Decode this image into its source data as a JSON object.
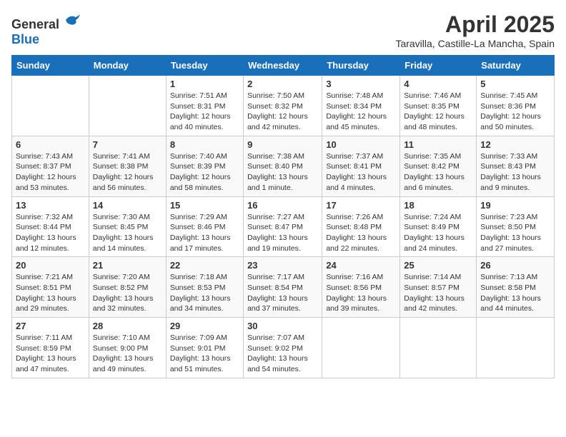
{
  "logo": {
    "general": "General",
    "blue": "Blue"
  },
  "title": "April 2025",
  "subtitle": "Taravilla, Castille-La Mancha, Spain",
  "days_of_week": [
    "Sunday",
    "Monday",
    "Tuesday",
    "Wednesday",
    "Thursday",
    "Friday",
    "Saturday"
  ],
  "weeks": [
    [
      {
        "day": "",
        "info": ""
      },
      {
        "day": "",
        "info": ""
      },
      {
        "day": "1",
        "info": "Sunrise: 7:51 AM\nSunset: 8:31 PM\nDaylight: 12 hours and 40 minutes."
      },
      {
        "day": "2",
        "info": "Sunrise: 7:50 AM\nSunset: 8:32 PM\nDaylight: 12 hours and 42 minutes."
      },
      {
        "day": "3",
        "info": "Sunrise: 7:48 AM\nSunset: 8:34 PM\nDaylight: 12 hours and 45 minutes."
      },
      {
        "day": "4",
        "info": "Sunrise: 7:46 AM\nSunset: 8:35 PM\nDaylight: 12 hours and 48 minutes."
      },
      {
        "day": "5",
        "info": "Sunrise: 7:45 AM\nSunset: 8:36 PM\nDaylight: 12 hours and 50 minutes."
      }
    ],
    [
      {
        "day": "6",
        "info": "Sunrise: 7:43 AM\nSunset: 8:37 PM\nDaylight: 12 hours and 53 minutes."
      },
      {
        "day": "7",
        "info": "Sunrise: 7:41 AM\nSunset: 8:38 PM\nDaylight: 12 hours and 56 minutes."
      },
      {
        "day": "8",
        "info": "Sunrise: 7:40 AM\nSunset: 8:39 PM\nDaylight: 12 hours and 58 minutes."
      },
      {
        "day": "9",
        "info": "Sunrise: 7:38 AM\nSunset: 8:40 PM\nDaylight: 13 hours and 1 minute."
      },
      {
        "day": "10",
        "info": "Sunrise: 7:37 AM\nSunset: 8:41 PM\nDaylight: 13 hours and 4 minutes."
      },
      {
        "day": "11",
        "info": "Sunrise: 7:35 AM\nSunset: 8:42 PM\nDaylight: 13 hours and 6 minutes."
      },
      {
        "day": "12",
        "info": "Sunrise: 7:33 AM\nSunset: 8:43 PM\nDaylight: 13 hours and 9 minutes."
      }
    ],
    [
      {
        "day": "13",
        "info": "Sunrise: 7:32 AM\nSunset: 8:44 PM\nDaylight: 13 hours and 12 minutes."
      },
      {
        "day": "14",
        "info": "Sunrise: 7:30 AM\nSunset: 8:45 PM\nDaylight: 13 hours and 14 minutes."
      },
      {
        "day": "15",
        "info": "Sunrise: 7:29 AM\nSunset: 8:46 PM\nDaylight: 13 hours and 17 minutes."
      },
      {
        "day": "16",
        "info": "Sunrise: 7:27 AM\nSunset: 8:47 PM\nDaylight: 13 hours and 19 minutes."
      },
      {
        "day": "17",
        "info": "Sunrise: 7:26 AM\nSunset: 8:48 PM\nDaylight: 13 hours and 22 minutes."
      },
      {
        "day": "18",
        "info": "Sunrise: 7:24 AM\nSunset: 8:49 PM\nDaylight: 13 hours and 24 minutes."
      },
      {
        "day": "19",
        "info": "Sunrise: 7:23 AM\nSunset: 8:50 PM\nDaylight: 13 hours and 27 minutes."
      }
    ],
    [
      {
        "day": "20",
        "info": "Sunrise: 7:21 AM\nSunset: 8:51 PM\nDaylight: 13 hours and 29 minutes."
      },
      {
        "day": "21",
        "info": "Sunrise: 7:20 AM\nSunset: 8:52 PM\nDaylight: 13 hours and 32 minutes."
      },
      {
        "day": "22",
        "info": "Sunrise: 7:18 AM\nSunset: 8:53 PM\nDaylight: 13 hours and 34 minutes."
      },
      {
        "day": "23",
        "info": "Sunrise: 7:17 AM\nSunset: 8:54 PM\nDaylight: 13 hours and 37 minutes."
      },
      {
        "day": "24",
        "info": "Sunrise: 7:16 AM\nSunset: 8:56 PM\nDaylight: 13 hours and 39 minutes."
      },
      {
        "day": "25",
        "info": "Sunrise: 7:14 AM\nSunset: 8:57 PM\nDaylight: 13 hours and 42 minutes."
      },
      {
        "day": "26",
        "info": "Sunrise: 7:13 AM\nSunset: 8:58 PM\nDaylight: 13 hours and 44 minutes."
      }
    ],
    [
      {
        "day": "27",
        "info": "Sunrise: 7:11 AM\nSunset: 8:59 PM\nDaylight: 13 hours and 47 minutes."
      },
      {
        "day": "28",
        "info": "Sunrise: 7:10 AM\nSunset: 9:00 PM\nDaylight: 13 hours and 49 minutes."
      },
      {
        "day": "29",
        "info": "Sunrise: 7:09 AM\nSunset: 9:01 PM\nDaylight: 13 hours and 51 minutes."
      },
      {
        "day": "30",
        "info": "Sunrise: 7:07 AM\nSunset: 9:02 PM\nDaylight: 13 hours and 54 minutes."
      },
      {
        "day": "",
        "info": ""
      },
      {
        "day": "",
        "info": ""
      },
      {
        "day": "",
        "info": ""
      }
    ]
  ]
}
